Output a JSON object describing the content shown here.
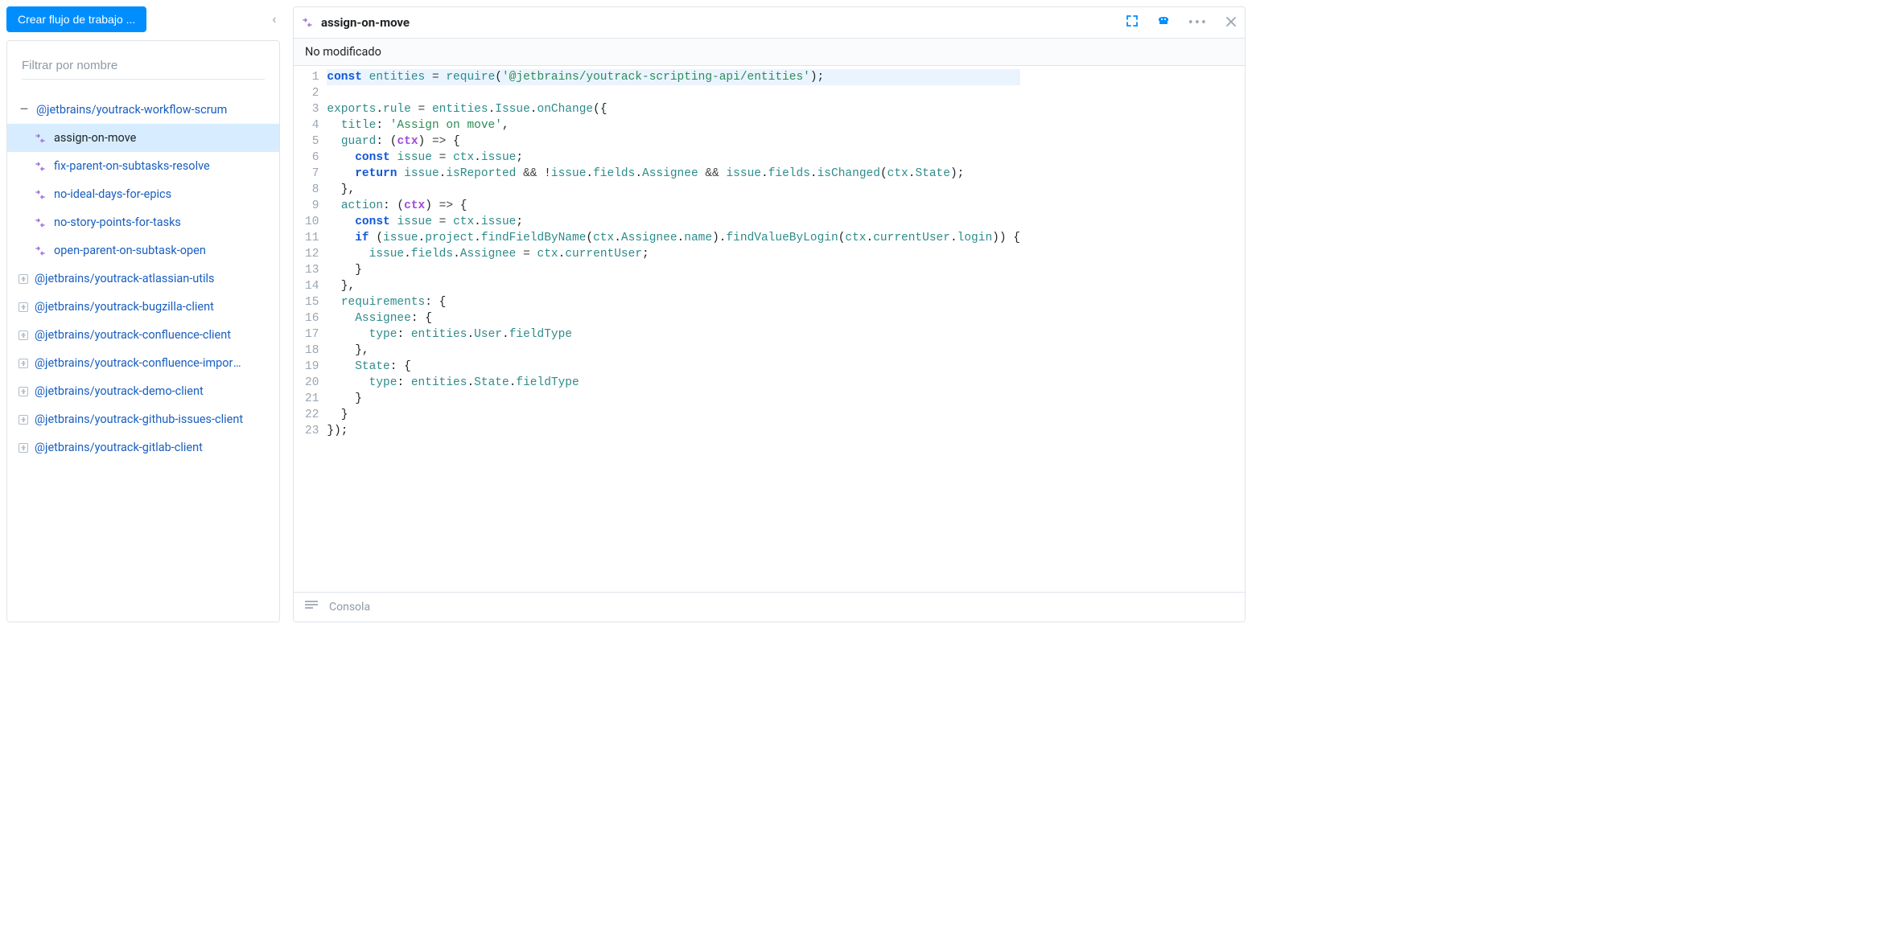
{
  "toolbar": {
    "create_label": "Crear flujo de trabajo ..."
  },
  "filter": {
    "placeholder": "Filtrar por nombre"
  },
  "tree": {
    "expanded": {
      "name": "@jetbrains/youtrack-workflow-scrum",
      "children": [
        {
          "name": "assign-on-move",
          "selected": true
        },
        {
          "name": "fix-parent-on-subtasks-resolve",
          "selected": false
        },
        {
          "name": "no-ideal-days-for-epics",
          "selected": false
        },
        {
          "name": "no-story-points-for-tasks",
          "selected": false
        },
        {
          "name": "open-parent-on-subtask-open",
          "selected": false
        }
      ]
    },
    "collapsed": [
      "@jetbrains/youtrack-atlassian-utils",
      "@jetbrains/youtrack-bugzilla-client",
      "@jetbrains/youtrack-confluence-client",
      "@jetbrains/youtrack-confluence-import-a...",
      "@jetbrains/youtrack-demo-client",
      "@jetbrains/youtrack-github-issues-client",
      "@jetbrains/youtrack-gitlab-client"
    ]
  },
  "editor": {
    "title": "assign-on-move",
    "status": "No modificado",
    "console_label": "Consola",
    "code_plain": "const entities = require('@jetbrains/youtrack-scripting-api/entities');\n\nexports.rule = entities.Issue.onChange({\n  title: 'Assign on move',\n  guard: (ctx) => {\n    const issue = ctx.issue;\n    return issue.isReported && !issue.fields.Assignee && issue.fields.isChanged(ctx.State);\n  },\n  action: (ctx) => {\n    const issue = ctx.issue;\n    if (issue.project.findFieldByName(ctx.Assignee.name).findValueByLogin(ctx.currentUser.login)) {\n      issue.fields.Assignee = ctx.currentUser;\n    }\n  },\n  requirements: {\n    Assignee: {\n      type: entities.User.fieldType\n    },\n    State: {\n      type: entities.State.fieldType\n    }\n  }\n});",
    "line_count": 23
  }
}
